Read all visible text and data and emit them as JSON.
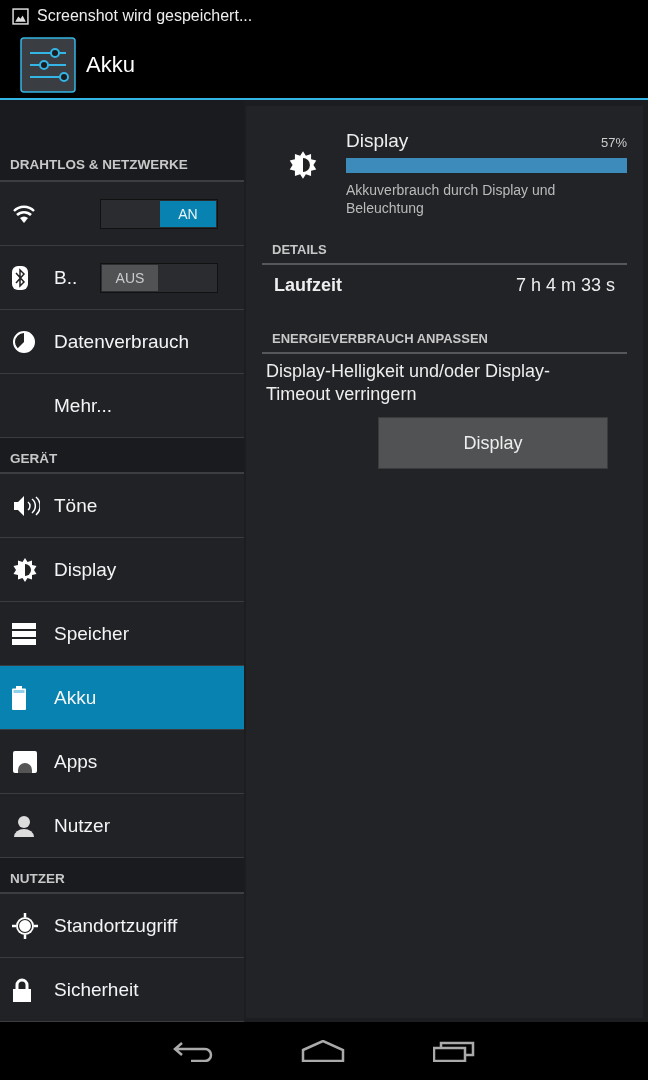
{
  "status_bar": {
    "notification": "Screenshot wird gespeichert..."
  },
  "action_bar": {
    "title": "Akku"
  },
  "sidebar": {
    "sections": [
      {
        "header": "DRAHTLOS & NETZWERKE",
        "items": [
          {
            "kind": "switch",
            "on": true,
            "switch_text": "AN",
            "selected": false
          },
          {
            "kind": "switch",
            "label": "B..",
            "on": false,
            "switch_text": "AUS",
            "selected": false
          },
          {
            "kind": "link",
            "label": "Datenverbrauch",
            "selected": false
          },
          {
            "kind": "link",
            "label": "Mehr...",
            "selected": false
          }
        ]
      },
      {
        "header": "GERÄT",
        "items": [
          {
            "kind": "link",
            "label": "Töne",
            "selected": false
          },
          {
            "kind": "link",
            "label": "Display",
            "selected": false
          },
          {
            "kind": "link",
            "label": "Speicher",
            "selected": false
          },
          {
            "kind": "link",
            "label": "Akku",
            "selected": true
          },
          {
            "kind": "link",
            "label": "Apps",
            "selected": false
          },
          {
            "kind": "link",
            "label": "Nutzer",
            "selected": false
          }
        ]
      },
      {
        "header": "NUTZER",
        "items": [
          {
            "kind": "link",
            "label": "Standortzugriff",
            "selected": false
          },
          {
            "kind": "link",
            "label": "Sicherheit",
            "selected": false
          }
        ]
      }
    ]
  },
  "detail": {
    "title": "Display",
    "percent": "57%",
    "level": 1,
    "summary": "Akkuverbrauch durch Display und Beleuchtung",
    "details_header": "DETAILS",
    "details": [
      {
        "label": "Laufzeit",
        "value": "7 h 4 m 33 s"
      }
    ],
    "adjust_header": "ENERGIEVERBRAUCH ANPASSEN",
    "adjust_text": "Display-Helligkeit und/oder Display-Timeout verringern",
    "button": "Display"
  }
}
